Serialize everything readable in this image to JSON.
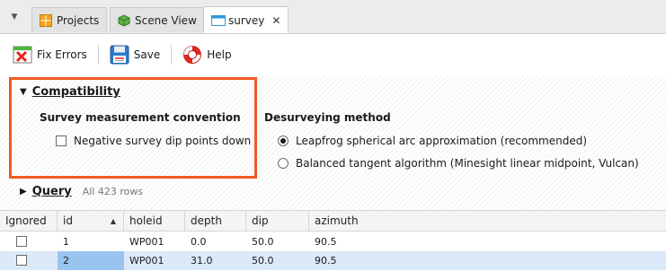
{
  "tabs": [
    {
      "label": "Projects",
      "icon": "projects-grid-icon",
      "active": false
    },
    {
      "label": "Scene View",
      "icon": "scene-cube-icon",
      "active": false
    },
    {
      "label": "survey",
      "icon": "table-icon",
      "active": true,
      "closable": true
    }
  ],
  "toolbar": {
    "fix_errors_label": "Fix Errors",
    "save_label": "Save",
    "help_label": "Help"
  },
  "compatibility": {
    "title": "Compatibility",
    "measurement_heading": "Survey measurement convention",
    "negative_dip_label": "Negative survey dip points down",
    "negative_dip_checked": false
  },
  "desurveying": {
    "heading": "Desurveying method",
    "options": [
      {
        "label": "Leapfrog spherical arc approximation (recommended)",
        "selected": true
      },
      {
        "label": "Balanced tangent algorithm (Minesight linear midpoint, Vulcan)",
        "selected": false
      }
    ]
  },
  "query": {
    "title": "Query",
    "count_text": "All 423 rows"
  },
  "table": {
    "columns": [
      "Ignored",
      "id",
      "holeid",
      "depth",
      "dip",
      "azimuth"
    ],
    "sort_column": "id",
    "rows": [
      {
        "ignored": false,
        "id": "1",
        "holeid": "WP001",
        "depth": "0.0",
        "dip": "50.0",
        "azimuth": "90.5",
        "selected": false
      },
      {
        "ignored": false,
        "id": "2",
        "holeid": "WP001",
        "depth": "31.0",
        "dip": "50.0",
        "azimuth": "90.5",
        "selected": true
      }
    ]
  },
  "colors": {
    "highlight_box": "#f05a24",
    "selected_row": "#dbe9f9",
    "selected_cell": "#9ac4f0"
  }
}
